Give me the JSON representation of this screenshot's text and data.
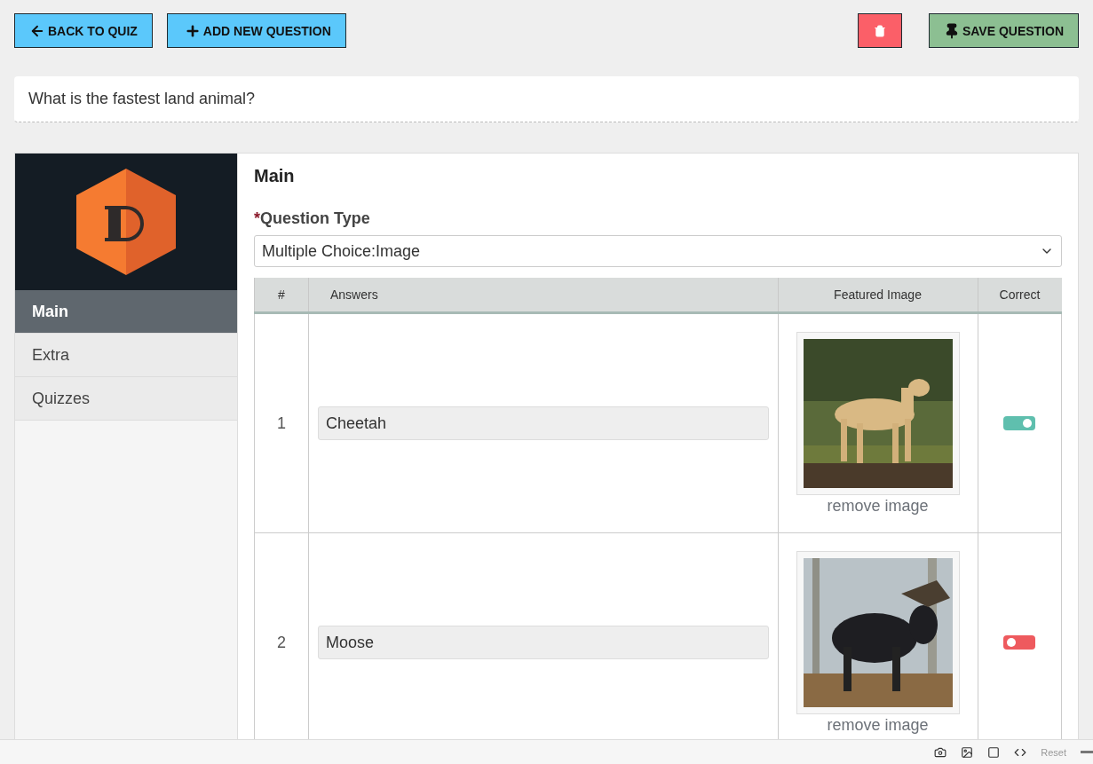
{
  "toolbar": {
    "back": "BACK TO QUIZ",
    "add": "ADD NEW QUESTION",
    "save": "SAVE QUESTION"
  },
  "question": {
    "value": "What is the fastest land animal?"
  },
  "sidebar": {
    "items": [
      {
        "label": "Main",
        "selected": true
      },
      {
        "label": "Extra",
        "selected": false
      },
      {
        "label": "Quizzes",
        "selected": false
      }
    ]
  },
  "main": {
    "title": "Main",
    "required_mark": "*",
    "type_label": "Question Type",
    "type_value": "Multiple Choice:Image"
  },
  "table": {
    "columns": [
      "#",
      "Answers",
      "Featured Image",
      "Correct"
    ],
    "rows": [
      {
        "number": "1",
        "answer": "Cheetah",
        "remove": "remove image",
        "correct": true
      },
      {
        "number": "2",
        "answer": "Moose",
        "remove": "remove image",
        "correct": false
      }
    ]
  },
  "bottom_bar": {
    "reset": "Reset"
  }
}
